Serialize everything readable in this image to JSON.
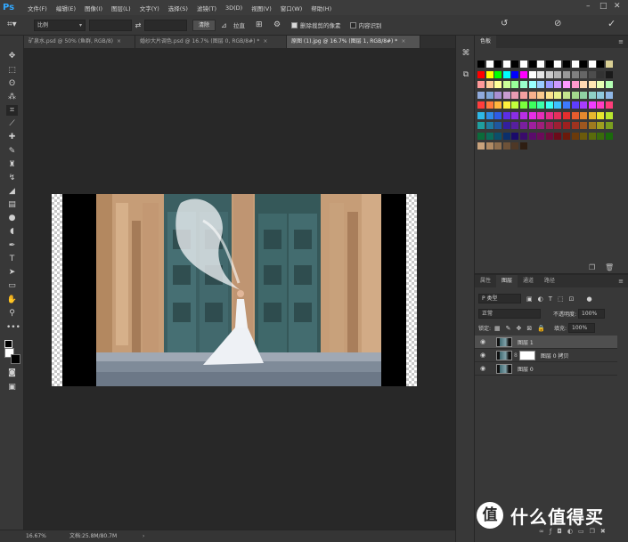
{
  "app": {
    "logo": "Ps"
  },
  "menu": [
    "文件(F)",
    "编辑(E)",
    "图像(I)",
    "图层(L)",
    "文字(Y)",
    "选择(S)",
    "滤镜(T)",
    "3D(D)",
    "视图(V)",
    "窗口(W)",
    "帮助(H)"
  ],
  "options": {
    "ratio_label": "比例",
    "clear_label": "清除",
    "straighten_label": "拉直",
    "delete_cropped_label": "删除裁剪的像素",
    "delete_cropped_checked": true,
    "content_aware_label": "内容识别",
    "content_aware_checked": false
  },
  "tabs": [
    {
      "label": "矿泉水.psd @ 50% (鱼群, RGB/8)",
      "close": "×",
      "active": false
    },
    {
      "label": "婚纱大片调色.psd @ 16.7% (图层 0, RGB/8#) *",
      "close": "×",
      "active": false
    },
    {
      "label": "原图 (1).jpg @ 16.7% (图层 1, RGB/8#) *",
      "close": "×",
      "active": true
    }
  ],
  "status": {
    "zoom": "16.67%",
    "doc": "文档:25.8M/80.7M"
  },
  "swatches": {
    "tab_label": "色板",
    "rows": [
      [
        "#000000",
        "#ffffff",
        "#000000",
        "#ffffff",
        "#000000",
        "#ffffff",
        "#000000",
        "#ffffff",
        "#000000",
        "#ffffff",
        "#000000",
        "#ffffff",
        "#000000",
        "#ffffff",
        "#000000",
        "#d9cf94"
      ],
      [
        "#ff0000",
        "#ffff00",
        "#00ff00",
        "#00ffff",
        "#0000ff",
        "#ff00ff",
        "#ffffff",
        "#e6e6e6",
        "#cccccc",
        "#b3b3b3",
        "#999999",
        "#808080",
        "#666666",
        "#4d4d4d",
        "#333333",
        "#1a1a1a"
      ],
      [
        "#ff9999",
        "#ffcc99",
        "#ffff99",
        "#ccff99",
        "#99ff99",
        "#99ffcc",
        "#99ffff",
        "#99ccff",
        "#9999ff",
        "#cc99ff",
        "#ff99ff",
        "#ff99cc",
        "#ffd9b3",
        "#ffe6b3",
        "#e6ffb3",
        "#b3ffb3"
      ],
      [
        "#8faadc",
        "#7fa5d6",
        "#a98fd1",
        "#c99bd1",
        "#e89bb3",
        "#f4a0a0",
        "#f7b08d",
        "#f9c98d",
        "#fbe28d",
        "#e9f08d",
        "#c5e48d",
        "#a3d88d",
        "#8fd1a4",
        "#8fd1c6",
        "#8fc9dd",
        "#8fb7e6"
      ],
      [
        "#ff3d3d",
        "#ff7a3d",
        "#ffb53d",
        "#fff03d",
        "#c2ff3d",
        "#7aff3d",
        "#3dff5e",
        "#3dffa8",
        "#3dfff0",
        "#3dc2ff",
        "#3d7aff",
        "#5e3dff",
        "#a83dff",
        "#f03dff",
        "#ff3dc2",
        "#ff3d7a"
      ],
      [
        "#2eb8e6",
        "#2e8ae6",
        "#2e5ce6",
        "#5c2ee6",
        "#8a2ee6",
        "#b82ee6",
        "#e62ee6",
        "#e62eb8",
        "#e62e8a",
        "#e62e5c",
        "#e62e2e",
        "#e65c2e",
        "#e68a2e",
        "#e6b82e",
        "#e6e62e",
        "#b8e62e"
      ],
      [
        "#1f9e9e",
        "#1f7a9e",
        "#1f579e",
        "#331f9e",
        "#571f9e",
        "#7a1f9e",
        "#9e1f9e",
        "#9e1f7a",
        "#9e1f57",
        "#9e1f33",
        "#9e1f1f",
        "#9e331f",
        "#9e571f",
        "#9e7a1f",
        "#9e9e1f",
        "#7a9e1f"
      ],
      [
        "#0b6b3a",
        "#0b6b5a",
        "#0b4f6b",
        "#0b2f6b",
        "#1a0b6b",
        "#3a0b6b",
        "#5a0b6b",
        "#6b0b5a",
        "#6b0b3a",
        "#6b0b1a",
        "#6b1a0b",
        "#6b3a0b",
        "#6b5a0b",
        "#5a6b0b",
        "#3a6b0b",
        "#1a6b0b"
      ],
      [
        "#c9a27c",
        "#b08a64",
        "#8e6e4e",
        "#6e5238",
        "#4e3826",
        "#2e1e12"
      ]
    ]
  },
  "layers": {
    "tabs": [
      "属性",
      "图层",
      "通道",
      "路径"
    ],
    "active_tab": "图层",
    "kind_filter": "P 类型",
    "blend_mode": "正常",
    "opacity_label": "不透明度:",
    "opacity_value": "100%",
    "lock_label": "锁定:",
    "fill_label": "填充:",
    "fill_value": "100%",
    "items": [
      {
        "name": "图层 1",
        "selected": true,
        "mask": false
      },
      {
        "name": "图层 0 拷贝",
        "selected": false,
        "mask": true
      },
      {
        "name": "图层 0",
        "selected": false,
        "mask": false
      }
    ]
  },
  "watermark": {
    "logo": "值",
    "text": "什么值得买"
  }
}
